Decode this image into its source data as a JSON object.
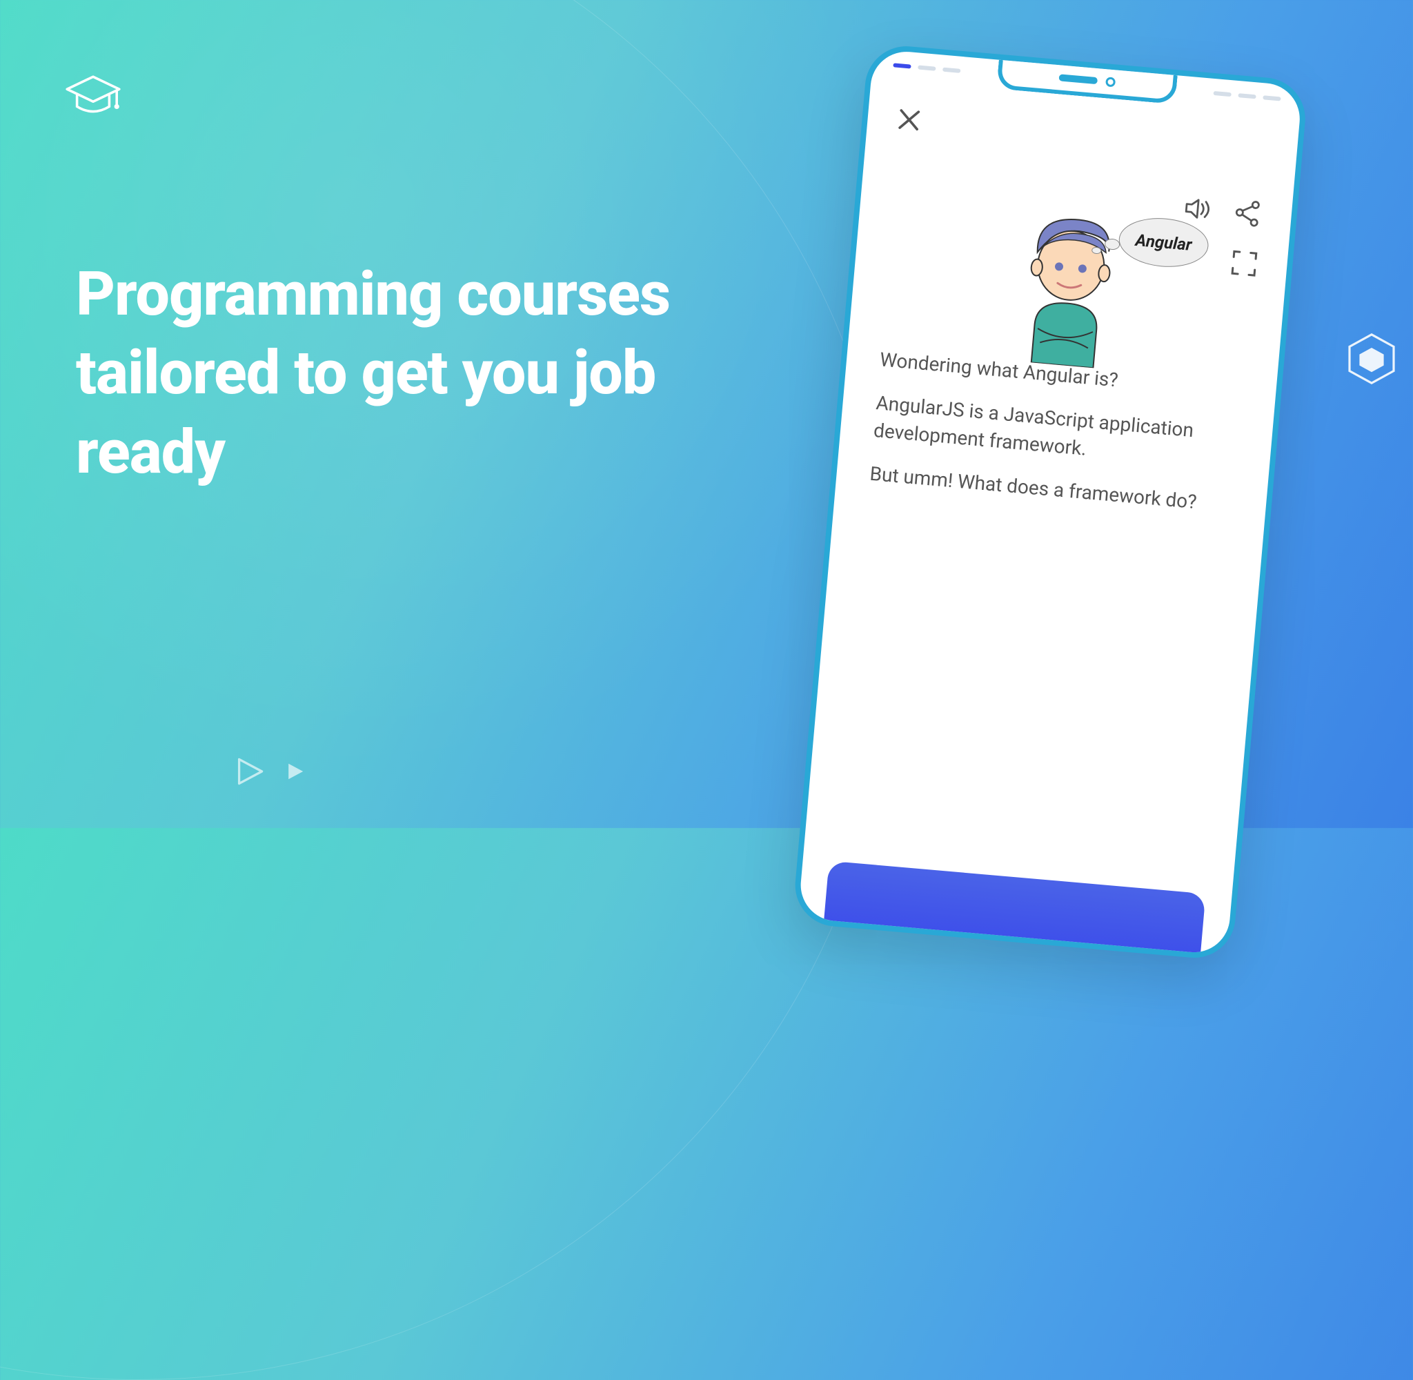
{
  "headline": "Programming courses tailored to get you job ready",
  "phone": {
    "thought_label": "Angular",
    "text_lines": [
      "Wondering what Angular is?",
      "AngularJS is a JavaScript application development framework.",
      "But umm! What does a framework do?"
    ]
  },
  "icons": {
    "cap": "graduation-cap",
    "hex": "hexagon",
    "play": "play-triangle"
  }
}
